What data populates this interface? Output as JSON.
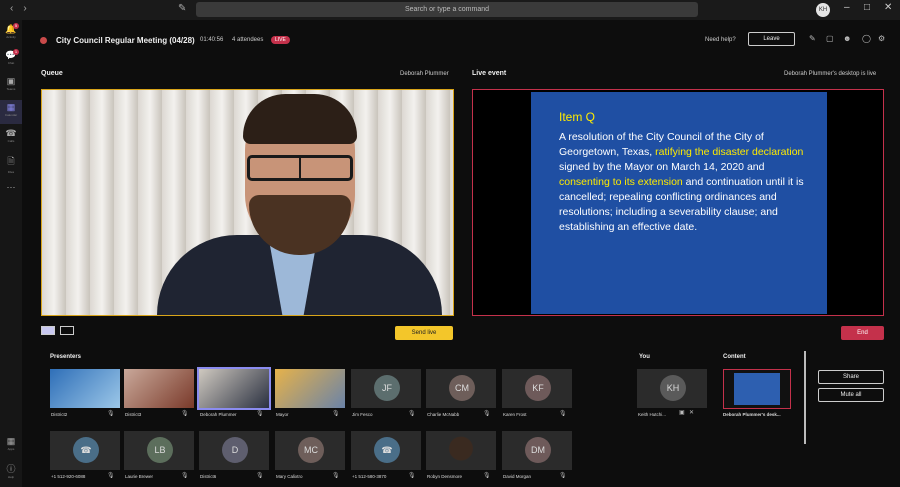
{
  "topbar": {
    "search_placeholder": "Search or type a command",
    "avatar_initials": "KH"
  },
  "rail": {
    "items": [
      {
        "label": "Activity",
        "icon": "bell-icon",
        "badge": "5"
      },
      {
        "label": "Chat",
        "icon": "chat-icon",
        "badge": "1"
      },
      {
        "label": "Teams",
        "icon": "teams-icon",
        "badge": ""
      },
      {
        "label": "Calendar",
        "icon": "calendar-icon",
        "badge": ""
      },
      {
        "label": "Calls",
        "icon": "phone-icon",
        "badge": ""
      },
      {
        "label": "Files",
        "icon": "file-icon",
        "badge": ""
      }
    ],
    "bottom": [
      {
        "label": "Apps",
        "icon": "apps-icon"
      },
      {
        "label": "Help",
        "icon": "help-icon"
      }
    ]
  },
  "meeting": {
    "title": "City Council Regular Meeting (04/28)",
    "elapsed": "01:40:56",
    "attendees": "4 attendees",
    "live_label": "LIVE",
    "need_help": "Need help?",
    "leave": "Leave"
  },
  "queue": {
    "label": "Queue",
    "presenter": "Deborah Plummer",
    "send_live": "Send live"
  },
  "live_event": {
    "label": "Live event",
    "source": "Deborah Plummer's desktop is live",
    "end": "End",
    "slide": {
      "heading": "Item Q",
      "text_1": "A resolution of the City Council of the City of Georgetown, Texas, ",
      "highlight_1": "ratifying the disaster declaration",
      "text_2": " signed by the Mayor on March 14, 2020 and ",
      "highlight_2": "consenting to its extension",
      "text_3": " and continuation until it is cancelled; repealing conflicting ordinances and resolutions; including a severability clause; and establishing an effective date."
    }
  },
  "presenters": {
    "label": "Presenters",
    "row1": [
      {
        "name": "District2",
        "initials": "",
        "type": "video"
      },
      {
        "name": "District3",
        "initials": "",
        "type": "video"
      },
      {
        "name": "Deborah Plummer",
        "initials": "",
        "type": "video",
        "selected": true
      },
      {
        "name": "Mayor",
        "initials": "",
        "type": "video"
      },
      {
        "name": "Jim Fesco",
        "initials": "JF",
        "type": "initials"
      },
      {
        "name": "Charlie McNabb",
        "initials": "CM",
        "type": "initials"
      },
      {
        "name": "Karen Frost",
        "initials": "KF",
        "type": "initials"
      }
    ],
    "row2": [
      {
        "name": "+1 512-920-6088",
        "initials": "",
        "type": "phone"
      },
      {
        "name": "Laurie Brewer",
        "initials": "LB",
        "type": "initials"
      },
      {
        "name": "District6",
        "initials": "D",
        "type": "initials"
      },
      {
        "name": "Mary Calixtro",
        "initials": "MC",
        "type": "initials"
      },
      {
        "name": "+1 512-580-3870",
        "initials": "",
        "type": "phone"
      },
      {
        "name": "Robyn Densmore",
        "initials": "",
        "type": "video"
      },
      {
        "name": "David Morgan",
        "initials": "DM",
        "type": "initials"
      }
    ]
  },
  "you": {
    "label": "You",
    "initials": "KH",
    "name": "Keith Hutchi..."
  },
  "content": {
    "label": "Content",
    "name": "Deborah Plummer's desk..."
  },
  "actions": {
    "share": "Share",
    "mute_all": "Mute all"
  },
  "colors": {
    "accent": "#8b8cf0",
    "live_red": "#c4314b",
    "send_live_yellow": "#f3c62a",
    "queue_border": "#d9a51a",
    "slide_blue": "#1f4fa3",
    "slide_highlight": "#ffeb00"
  }
}
